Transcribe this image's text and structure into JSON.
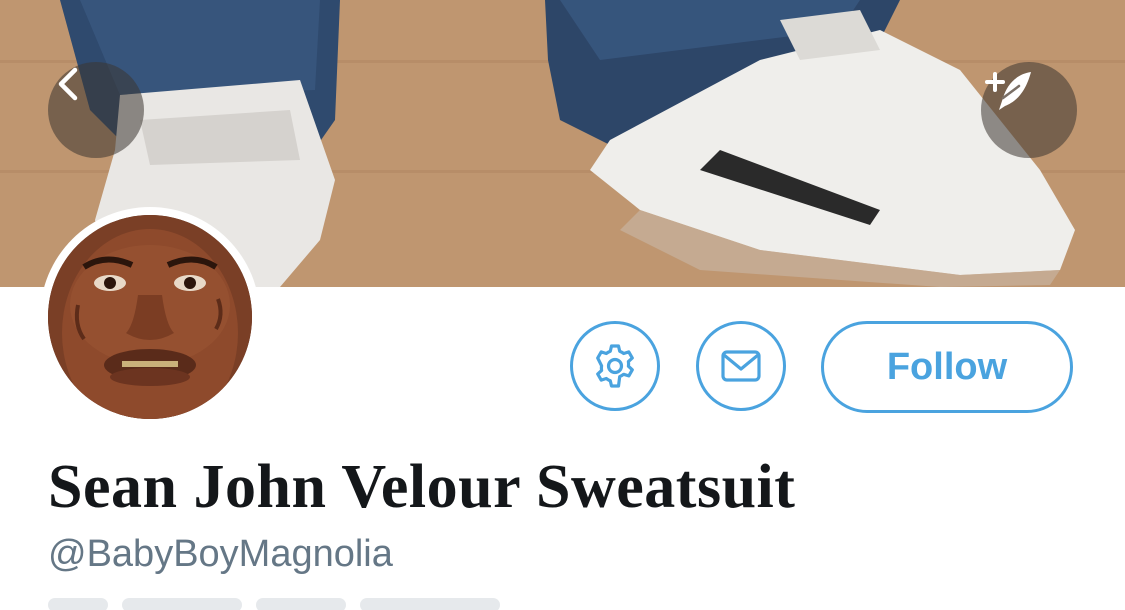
{
  "header": {
    "back_icon": "chevron-left-icon",
    "compose_icon": "compose-tweet-icon"
  },
  "profile": {
    "display_name": "Sean John Velour Sweatsuit",
    "handle": "@BabyBoyMagnolia"
  },
  "actions": {
    "settings_icon": "gear-icon",
    "message_icon": "envelope-icon",
    "follow_label": "Follow"
  },
  "colors": {
    "accent": "#4aa3df",
    "name_text": "#14171a",
    "handle_text": "#657786"
  }
}
